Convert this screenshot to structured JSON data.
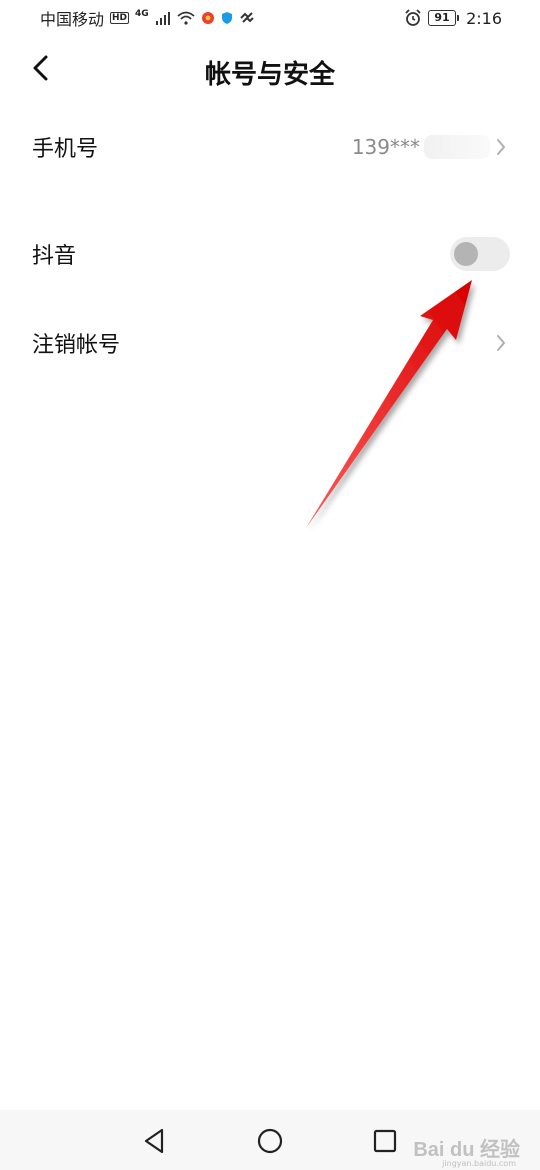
{
  "status_bar": {
    "carrier": "中国移动",
    "hd": "HD",
    "network": "4G",
    "battery": "91",
    "time": "2:16"
  },
  "header": {
    "title": "帐号与安全"
  },
  "settings": {
    "phone": {
      "label": "手机号",
      "value": "139***"
    },
    "douyin": {
      "label": "抖音",
      "enabled": false
    },
    "deactivate": {
      "label": "注销帐号"
    }
  },
  "watermark": {
    "brand": "Bai du 经验",
    "url": "jingyan.baidu.com"
  },
  "colors": {
    "annotation_arrow": "#e8141a",
    "toggle_track": "#ececec",
    "toggle_knob": "#b4b4b4"
  }
}
